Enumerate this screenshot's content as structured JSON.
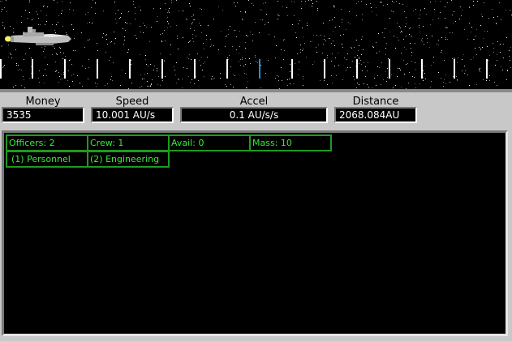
{
  "stats": {
    "money_label": "Money",
    "money_value": "3535",
    "speed_label": "Speed",
    "speed_value": "10.001 AU/s",
    "accel_label": "Accel",
    "accel_value": "0.1 AU/s/s",
    "distance_label": "Distance",
    "distance_value": "2068.084AU"
  },
  "crew": {
    "officers": "Officers: 2",
    "crew": "Crew: 1",
    "avail": "Avail: 0",
    "mass": "Mass: 10"
  },
  "stations": {
    "personnel": "(1) Personnel",
    "engineering": "(2) Engineering"
  },
  "colors": {
    "grid_green": "#1f9a1f",
    "text_green": "#33ee33",
    "current_marker": "#2a8fd6"
  },
  "icons": {
    "ship": "spaceship-icon"
  }
}
